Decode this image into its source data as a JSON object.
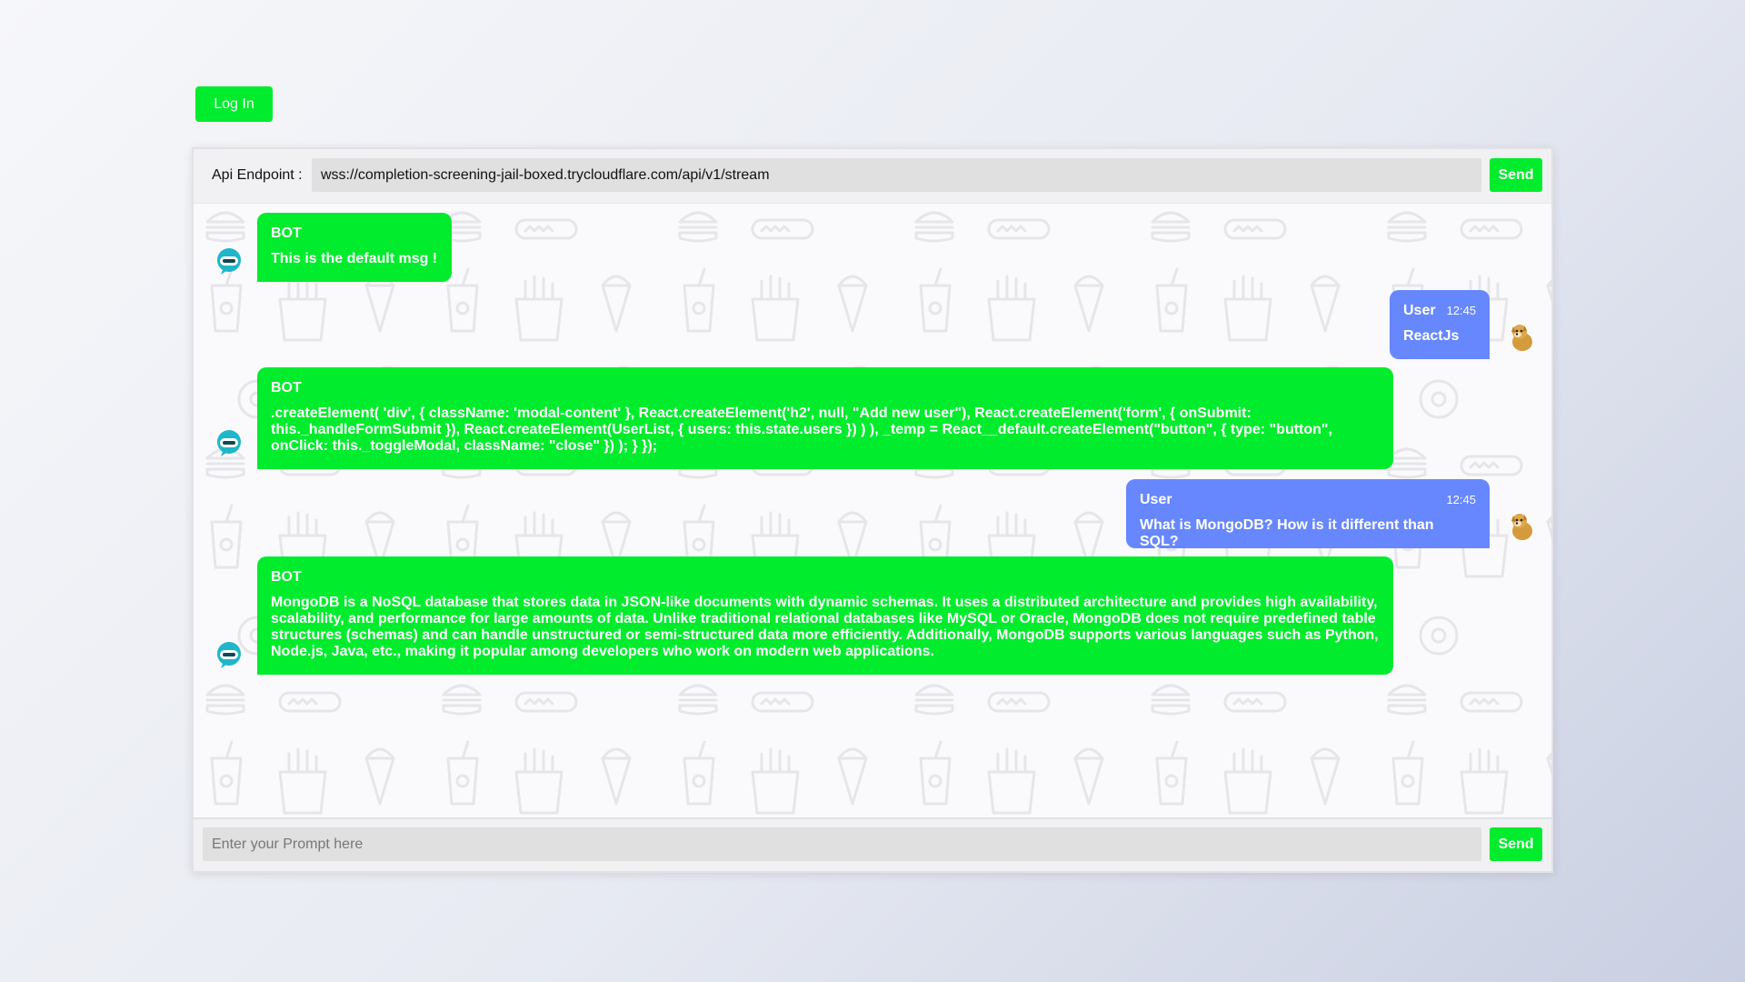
{
  "header": {
    "login_label": "Log In"
  },
  "endpoint": {
    "label": "Api Endpoint :",
    "value": "wss://completion-screening-jail-boxed.trycloudflare.com/api/v1/stream",
    "send_label": "Send"
  },
  "messages": [
    {
      "role": "bot",
      "sender": "BOT",
      "time": "",
      "text": "This is the default msg !",
      "avatar_icon": "bot-icon"
    },
    {
      "role": "user",
      "sender": "User",
      "time": "12:45",
      "text": "ReactJs",
      "avatar_icon": "dog-icon"
    },
    {
      "role": "bot",
      "sender": "BOT",
      "time": "",
      "text": ".createElement( 'div', { className: 'modal-content' }, React.createElement('h2', null, \"Add new user\"), React.createElement('form', { onSubmit: this._handleFormSubmit }), React.createElement(UserList, { users: this.state.users }) ) ), _temp = React__default.createElement(\"button\", { type: \"button\", onClick: this._toggleModal, className: \"close\" }) ); } });",
      "avatar_icon": "bot-icon"
    },
    {
      "role": "user",
      "sender": "User",
      "time": "12:45",
      "text": "What is MongoDB? How is it different than SQL?",
      "avatar_icon": "dog-icon"
    },
    {
      "role": "bot",
      "sender": "BOT",
      "time": "",
      "text": "MongoDB is a NoSQL database that stores data in JSON-like documents with dynamic schemas. It uses a distributed architecture and provides high availability, scalability, and performance for large amounts of data. Unlike traditional relational databases like MySQL or Oracle, MongoDB does not require predefined table structures (schemas) and can handle unstructured or semi-structured data more efficiently. Additionally, MongoDB supports various languages such as Python, Node.js, Java, etc., making it popular among developers who work on modern web applications.",
      "avatar_icon": "bot-icon"
    }
  ],
  "composer": {
    "placeholder": "Enter your Prompt here",
    "send_label": "Send"
  },
  "colors": {
    "accent_green": "#00ec2c",
    "user_blue": "#6787ff"
  }
}
